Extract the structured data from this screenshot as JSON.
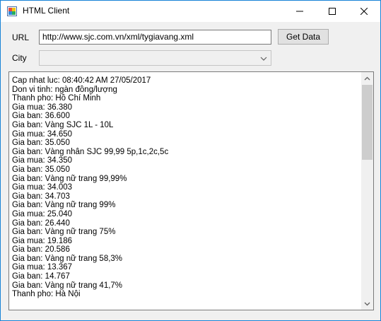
{
  "window": {
    "title": "HTML Client"
  },
  "form": {
    "url_label": "URL",
    "url_value": "http://www.sjc.com.vn/xml/tygiavang.xml",
    "get_button": "Get Data",
    "city_label": "City",
    "city_value": ""
  },
  "output": {
    "lines": [
      "Cap nhat luc: 08:40:42 AM 27/05/2017",
      "Don vi tinh: ngàn đồng/lượng",
      "Thanh pho: Hồ Chí Minh",
      "Gia mua: 36.380",
      "Gia ban: 36.600",
      "Gia ban: Vàng SJC 1L - 10L",
      "Gia mua: 34.650",
      "Gia ban: 35.050",
      "Gia ban: Vàng nhẫn SJC 99,99 5p,1c,2c,5c",
      "Gia mua: 34.350",
      "Gia ban: 35.050",
      "Gia ban: Vàng nữ trang 99,99%",
      "Gia mua: 34.003",
      "Gia ban: 34.703",
      "Gia ban: Vàng nữ trang 99%",
      "Gia mua: 25.040",
      "Gia ban: 26.440",
      "Gia ban: Vàng nữ trang 75%",
      "Gia mua: 19.186",
      "Gia ban: 20.586",
      "Gia ban: Vàng nữ trang 58,3%",
      "Gia mua: 13.367",
      "Gia ban: 14.767",
      "Gia ban: Vàng nữ trang 41,7%",
      "Thanh pho: Hà Nội"
    ]
  },
  "icons": {
    "app": "app-window-icon",
    "minimize": "minimize-icon",
    "maximize": "maximize-icon",
    "close": "close-icon",
    "dropdown": "chevron-down-icon",
    "scroll_up": "scroll-up-icon",
    "scroll_down": "scroll-down-icon"
  },
  "colors": {
    "window_border": "#1883d7",
    "window_bg": "#f0f0f0",
    "scroll_thumb": "#cdcdcd"
  }
}
